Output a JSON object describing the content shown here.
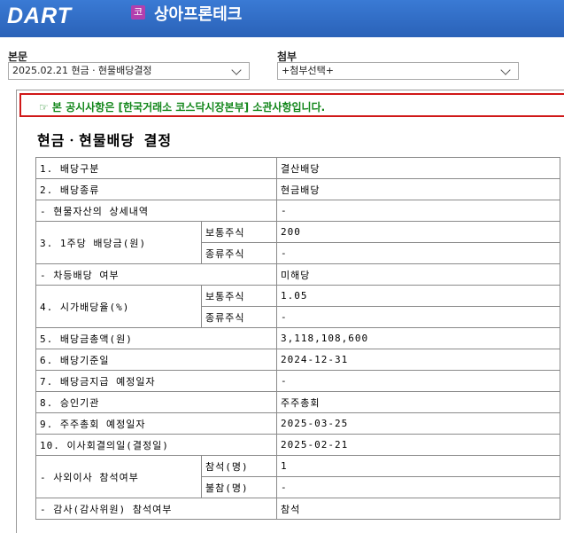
{
  "header": {
    "logo": "DART",
    "company_badge": "코",
    "company_name": "상아프론테크"
  },
  "main_doc": {
    "label": "본문",
    "selected": "2025.02.21  현금ㆍ현물배당결정"
  },
  "attachment": {
    "label": "첨부",
    "selected": "+첨부선택+"
  },
  "notice": "☞ 본 공시사항은 [한국거래소 코스닥시장본부] 소관사항입니다.",
  "doc_title": "현금ㆍ현물배당 결정",
  "rows": {
    "r1": {
      "label": "1. 배당구분",
      "value": "결산배당"
    },
    "r2": {
      "label": "2. 배당종류",
      "value": "현금배당"
    },
    "r3": {
      "label": "- 현물자산의 상세내역",
      "value": "-"
    },
    "r4": {
      "label": "3. 1주당 배당금(원)",
      "sub1": "보통주식",
      "val1": "200",
      "sub2": "종류주식",
      "val2": "-"
    },
    "r5": {
      "label": "- 차등배당 여부",
      "value": "미해당"
    },
    "r6": {
      "label": "4. 시가배당율(%)",
      "sub1": "보통주식",
      "val1": "1.05",
      "sub2": "종류주식",
      "val2": "-"
    },
    "r7": {
      "label": "5. 배당금총액(원)",
      "value": "3,118,108,600"
    },
    "r8": {
      "label": "6. 배당기준일",
      "value": "2024-12-31"
    },
    "r9": {
      "label": "7. 배당금지급 예정일자",
      "value": "-"
    },
    "r10": {
      "label": "8. 승인기관",
      "value": "주주총회"
    },
    "r11": {
      "label": "9. 주주총회 예정일자",
      "value": "2025-03-25"
    },
    "r12": {
      "label": "10. 이사회결의일(결정일)",
      "value": "2025-02-21"
    },
    "r13": {
      "label": "- 사외이사 참석여부",
      "sub1": "참석(명)",
      "val1": "1",
      "sub2": "불참(명)",
      "val2": "-"
    },
    "r14": {
      "label": "- 감사(감사위원) 참석여부",
      "value": "참석"
    }
  }
}
